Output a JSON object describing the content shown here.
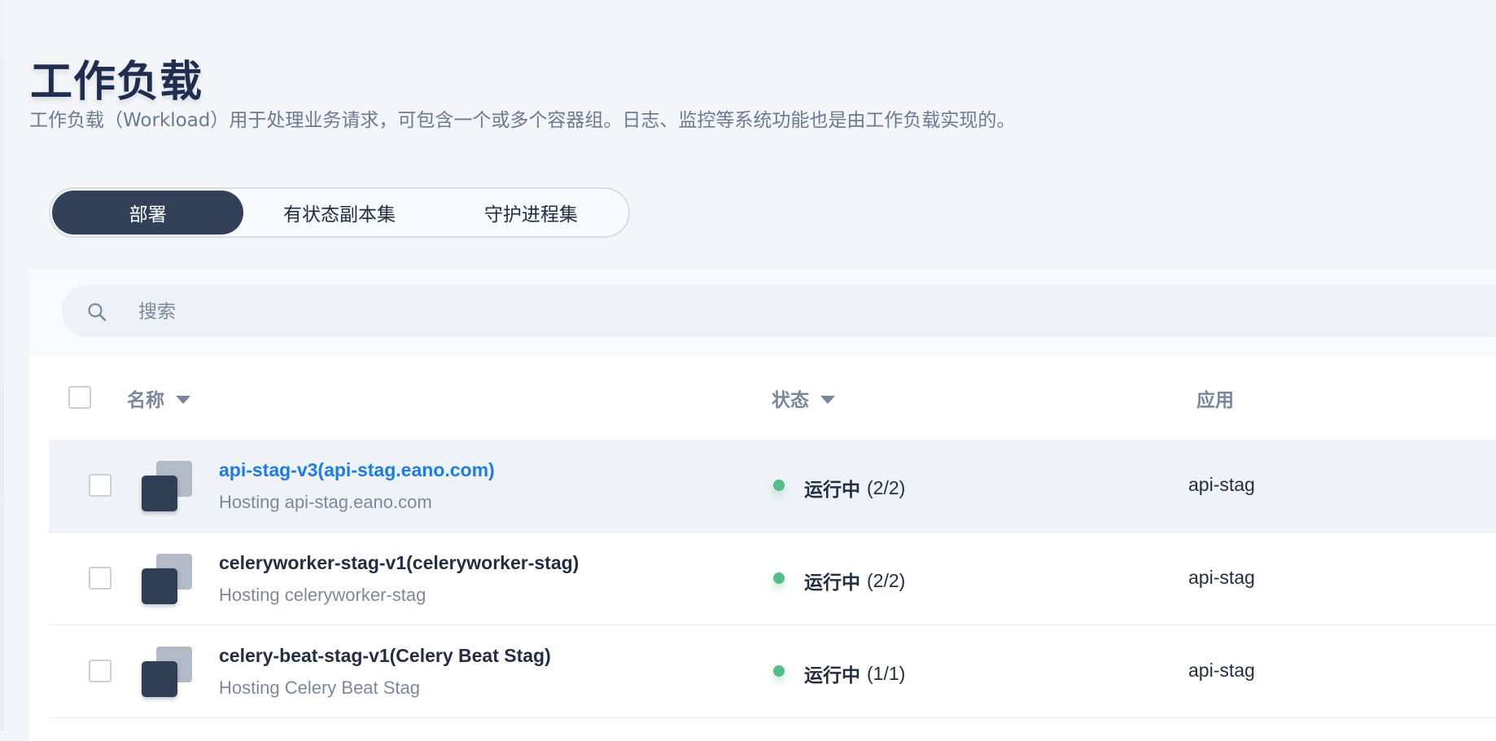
{
  "page": {
    "title": "工作负载",
    "description": "工作负载（Workload）用于处理业务请求，可包含一个或多个容器组。日志、监控等系统功能也是由工作负载实现的。"
  },
  "tabs": [
    {
      "label": "部署",
      "active": true
    },
    {
      "label": "有状态副本集",
      "active": false
    },
    {
      "label": "守护进程集",
      "active": false
    }
  ],
  "search": {
    "placeholder": "搜索",
    "icon": "search-icon"
  },
  "table": {
    "columns": {
      "name": "名称",
      "status": "状态",
      "app": "应用"
    },
    "rows": [
      {
        "name": "api-stag-v3(api-stag.eano.com)",
        "subtitle": "Hosting api-stag.eano.com",
        "status_label": "运行中",
        "status_count": "(2/2)",
        "app": "api-stag",
        "highlighted": true
      },
      {
        "name": "celeryworker-stag-v1(celeryworker-stag)",
        "subtitle": "Hosting celeryworker-stag",
        "status_label": "运行中",
        "status_count": "(2/2)",
        "app": "api-stag",
        "highlighted": false
      },
      {
        "name": "celery-beat-stag-v1(Celery Beat Stag)",
        "subtitle": "Hosting Celery Beat Stag",
        "status_label": "运行中",
        "status_count": "(1/1)",
        "app": "api-stag",
        "highlighted": false
      }
    ]
  },
  "colors": {
    "accent_dark": "#324058",
    "link": "#1c7be6",
    "status_running": "#55bc8a"
  }
}
